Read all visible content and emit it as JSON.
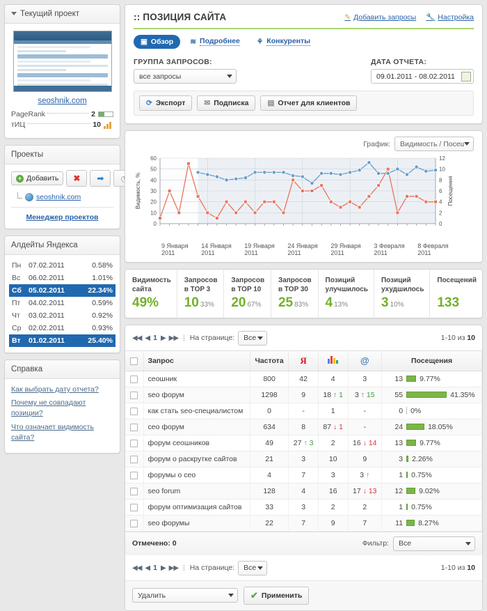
{
  "sidebar": {
    "current_project": {
      "title": "Текущий проект",
      "site": "seoshnik.com",
      "metrics": [
        {
          "name": "PageRank",
          "value": "2",
          "icon": "pagerank-bar"
        },
        {
          "name": "тИЦ",
          "value": "10",
          "icon": "tic-chart-icon"
        }
      ]
    },
    "projects": {
      "title": "Проекты",
      "add_label": "Добавить",
      "tools": [
        "add-project-button",
        "delete-project-button",
        "move-project-button",
        "history-project-button"
      ],
      "items": [
        {
          "label": "seoshnik.com"
        }
      ],
      "manager_link": "Менеджер проектов"
    },
    "updates": {
      "title": "Алдейты Яндекса",
      "rows": [
        {
          "day": "Пн",
          "date": "07.02.2011",
          "pct": "0.58%",
          "hl": false,
          "sun": false
        },
        {
          "day": "Вс",
          "date": "06.02.2011",
          "pct": "1.01%",
          "hl": false,
          "sun": true
        },
        {
          "day": "Сб",
          "date": "05.02.2011",
          "pct": "22.34%",
          "hl": true,
          "sun": true
        },
        {
          "day": "Пт",
          "date": "04.02.2011",
          "pct": "0.59%",
          "hl": false,
          "sun": false
        },
        {
          "day": "Чт",
          "date": "03.02.2011",
          "pct": "0.92%",
          "hl": false,
          "sun": false
        },
        {
          "day": "Ср",
          "date": "02.02.2011",
          "pct": "0.93%",
          "hl": false,
          "sun": false
        },
        {
          "day": "Вт",
          "date": "01.02.2011",
          "pct": "25.40%",
          "hl": true,
          "sun": false
        }
      ]
    },
    "help": {
      "title": "Справка",
      "links": [
        "Как выбрать дату отчета?",
        "Почему не совпадают позиции?",
        "Что означает видимость сайта?"
      ]
    }
  },
  "header": {
    "title": ":: ПОЗИЦИЯ САЙТА",
    "actions": [
      {
        "label": "Добавить запросы",
        "icon": "pencil-icon"
      },
      {
        "label": "Настройка",
        "icon": "wrench-icon"
      }
    ],
    "tabs": [
      {
        "label": "Обзор",
        "icon": "overview-icon",
        "active": true
      },
      {
        "label": "Подробнее",
        "icon": "details-icon",
        "active": false
      },
      {
        "label": "Конкуренты",
        "icon": "competitors-icon",
        "active": false
      }
    ]
  },
  "filters": {
    "group_label": "ГРУППА ЗАПРОСОВ:",
    "group_value": "все запросы",
    "date_label": "ДАТА ОТЧЕТА:",
    "date_value": "09.01.2011 - 08.02.2011"
  },
  "toolbar": {
    "export_label": "Экспорт",
    "subscribe_label": "Подписка",
    "client_report_label": "Отчет для клиентов"
  },
  "chart_panel": {
    "select_label": "График:",
    "select_value": "Видимость / Посещаемс"
  },
  "chart_data": {
    "type": "line",
    "title": "",
    "xlabel": "",
    "ylabel": "Видимость, %",
    "y2label": "Посещения",
    "ylim": [
      0,
      60
    ],
    "y2lim": [
      0,
      12
    ],
    "yticks": [
      0,
      10,
      20,
      30,
      40,
      50,
      60
    ],
    "y2ticks": [
      0,
      2,
      4,
      6,
      8,
      10,
      12
    ],
    "grid": true,
    "legend": "none",
    "xtick_labels": [
      "9 Января 2011",
      "14 Января 2011",
      "19 Января 2011",
      "24 Января 2011",
      "29 Января 2011",
      "3 Февраля 2011",
      "8 Февраля 2011"
    ],
    "series": [
      {
        "name": "Видимость, %",
        "color": "#e8755a",
        "axis": "left",
        "marker": "square",
        "values": [
          5,
          30,
          10,
          55,
          25,
          10,
          5,
          20,
          10,
          20,
          10,
          20,
          20,
          10,
          40,
          30,
          30,
          35,
          20,
          15,
          20,
          15,
          25,
          35,
          50,
          10,
          25,
          25,
          20,
          20
        ]
      },
      {
        "name": "Посещения",
        "color": "#6b9ec7",
        "axis": "right",
        "marker": "circle",
        "values": [
          null,
          null,
          null,
          null,
          9.4,
          9.0,
          8.6,
          8.0,
          8.2,
          8.4,
          9.4,
          9.4,
          9.4,
          9.4,
          8.8,
          8.6,
          7.4,
          9.2,
          9.2,
          9.0,
          9.4,
          9.8,
          11.2,
          9.2,
          9.2,
          10.0,
          9.0,
          10.4,
          9.6,
          9.8
        ]
      }
    ]
  },
  "stats": [
    {
      "label": "Видимость сайта",
      "value": "49%",
      "sub": ""
    },
    {
      "label": "Запросов в TOP 3",
      "value": "10",
      "sub": "33%"
    },
    {
      "label": "Запросов в TOP 10",
      "value": "20",
      "sub": "67%"
    },
    {
      "label": "Запросов в TOP 30",
      "value": "25",
      "sub": "83%"
    },
    {
      "label": "Позиций улучшилось",
      "value": "4",
      "sub": "13%"
    },
    {
      "label": "Позиций ухудшилось",
      "value": "3",
      "sub": "10%"
    },
    {
      "label": "Посещений",
      "value": "133",
      "sub": ""
    }
  ],
  "pager": {
    "first": "◀◀",
    "prev": "◀",
    "page": "1",
    "next": "▶",
    "last": "▶▶",
    "per_page_label": "На странице:",
    "per_page_value": "Все",
    "range": "1-10 из ",
    "total": "10"
  },
  "table": {
    "columns": [
      "",
      "Запрос",
      "Частота",
      "Я",
      "G",
      "@",
      "Посещения"
    ],
    "rows": [
      {
        "query": "сеошник",
        "freq": "800",
        "ya": "42",
        "ya_d": "",
        "ya_dir": "",
        "g": "4",
        "g_d": "",
        "g_dir": "",
        "at": "3",
        "at_d": "",
        "at_dir": "",
        "visits": "13",
        "bar": 14,
        "pct": "9.77%"
      },
      {
        "query": "seo форум",
        "freq": "1298",
        "ya": "9",
        "ya_d": "",
        "ya_dir": "",
        "g": "18",
        "g_d": "1",
        "g_dir": "up",
        "at": "3",
        "at_d": "15",
        "at_dir": "up",
        "visits": "55",
        "bar": 58,
        "pct": "41.35%"
      },
      {
        "query": "как стать seo-специалистом",
        "freq": "0",
        "ya": "-",
        "ya_d": "",
        "ya_dir": "",
        "g": "1",
        "g_d": "",
        "g_dir": "",
        "at": "-",
        "at_d": "",
        "at_dir": "",
        "visits": "0",
        "bar": 0,
        "pct": "0%"
      },
      {
        "query": "сео форум",
        "freq": "634",
        "ya": "8",
        "ya_d": "",
        "ya_dir": "",
        "g": "87",
        "g_d": "1",
        "g_dir": "dn",
        "at": "-",
        "at_d": "",
        "at_dir": "",
        "visits": "24",
        "bar": 26,
        "pct": "18.05%"
      },
      {
        "query": "форум сеошников",
        "freq": "49",
        "ya": "27",
        "ya_d": "3",
        "ya_dir": "up",
        "g": "2",
        "g_d": "",
        "g_dir": "",
        "at": "16",
        "at_d": "14",
        "at_dir": "dn",
        "visits": "13",
        "bar": 14,
        "pct": "9.77%"
      },
      {
        "query": "форум о раскрутке сайтов",
        "freq": "21",
        "ya": "3",
        "ya_d": "",
        "ya_dir": "",
        "g": "10",
        "g_d": "",
        "g_dir": "",
        "at": "9",
        "at_d": "",
        "at_dir": "",
        "visits": "3",
        "bar": 3,
        "pct": "2.26%"
      },
      {
        "query": "форумы о сео",
        "freq": "4",
        "ya": "7",
        "ya_d": "",
        "ya_dir": "",
        "g": "3",
        "g_d": "",
        "g_dir": "",
        "at": "3",
        "at_d": "",
        "at_dir": "up",
        "visits": "1",
        "bar": 2,
        "pct": "0.75%"
      },
      {
        "query": "seo forum",
        "freq": "128",
        "ya": "4",
        "ya_d": "",
        "ya_dir": "",
        "g": "16",
        "g_d": "",
        "g_dir": "",
        "at": "17",
        "at_d": "13",
        "at_dir": "dn",
        "visits": "12",
        "bar": 13,
        "pct": "9.02%"
      },
      {
        "query": "форум оптимизация сайтов",
        "freq": "33",
        "ya": "3",
        "ya_d": "",
        "ya_dir": "",
        "g": "2",
        "g_d": "",
        "g_dir": "",
        "at": "2",
        "at_d": "",
        "at_dir": "",
        "visits": "1",
        "bar": 2,
        "pct": "0.75%"
      },
      {
        "query": "seo форумы",
        "freq": "22",
        "ya": "7",
        "ya_d": "",
        "ya_dir": "",
        "g": "9",
        "g_d": "",
        "g_dir": "",
        "at": "7",
        "at_d": "",
        "at_dir": "",
        "visits": "11",
        "bar": 12,
        "pct": "8.27%"
      }
    ],
    "checked_label": "Отмечено: 0",
    "filter_label": "Фильтр:",
    "filter_value": "Все"
  },
  "actions": {
    "select_value": "Удалить",
    "apply_label": "Применить"
  }
}
